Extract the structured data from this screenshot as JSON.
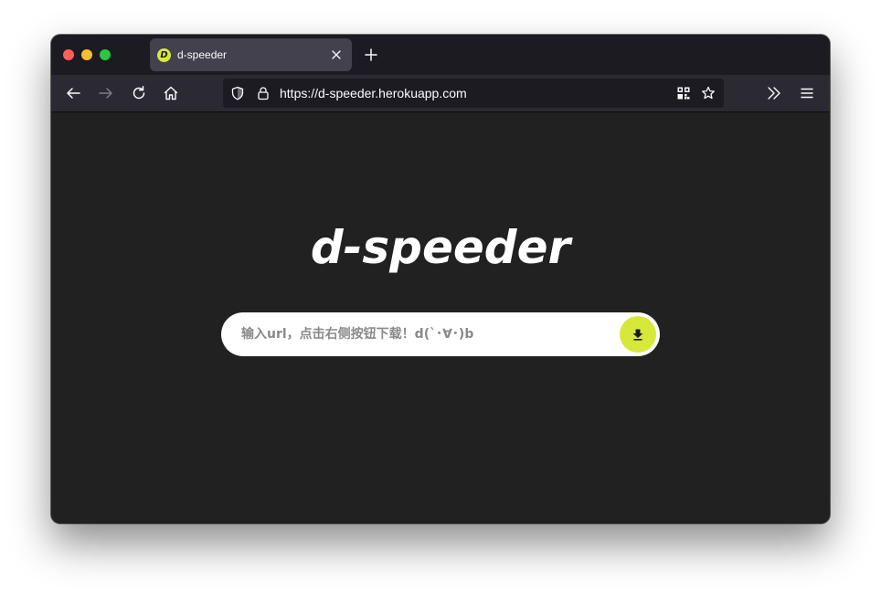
{
  "browser": {
    "tab": {
      "title": "d-speeder",
      "favicon_letter": "D",
      "favicon_color": "#d6e93b"
    },
    "url": "https://d-speeder.herokuapp.com",
    "icons": {
      "back": "arrow-left-icon",
      "forward": "arrow-right-icon",
      "reload": "reload-icon",
      "home": "home-icon",
      "shield": "shield-icon",
      "lock": "lock-icon",
      "qr": "qr-code-icon",
      "bookmark": "star-icon",
      "overflow": "chevron-double-right-icon",
      "menu": "hamburger-menu-icon"
    }
  },
  "page": {
    "logo": "d-speeder",
    "search": {
      "placeholder": "输入url，点击右侧按钮下载！d(`･∀･)b",
      "value": ""
    },
    "download_button_icon": "download-arrow-icon",
    "accent_color": "#d6e93b",
    "background_color": "#212121"
  }
}
